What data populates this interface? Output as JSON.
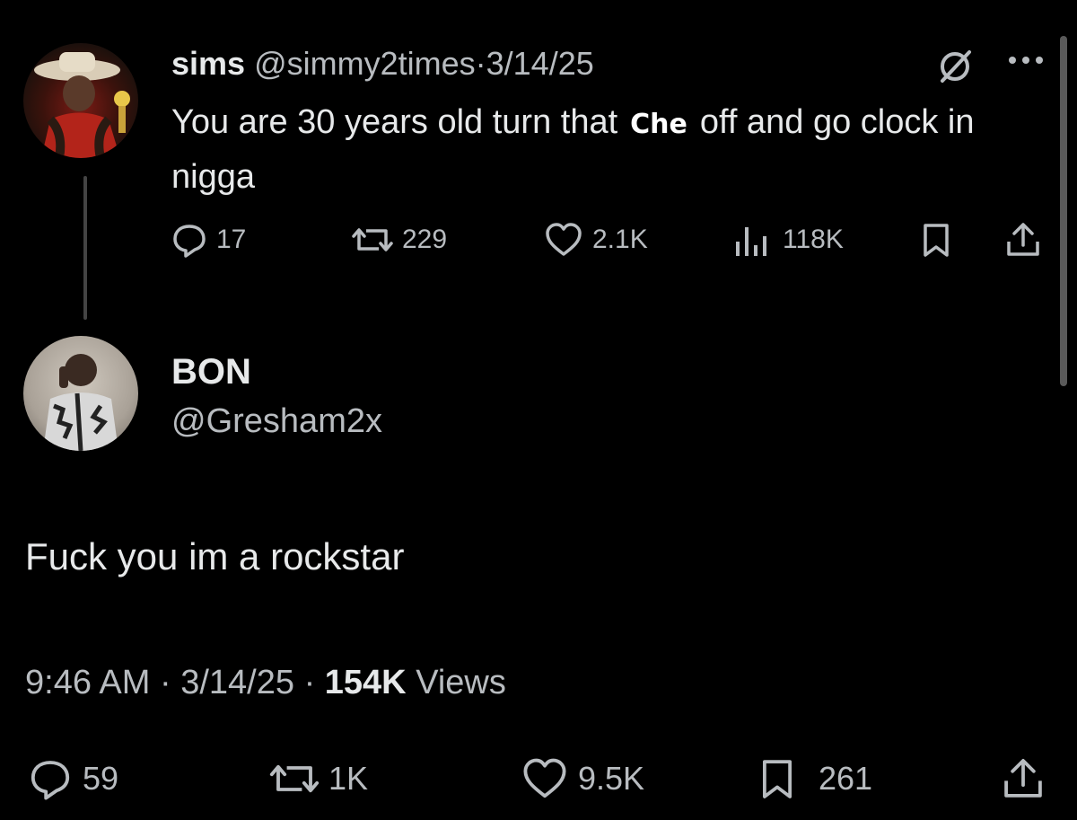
{
  "original_tweet": {
    "display_name": "sims",
    "handle": "@simmy2times",
    "separator": "·",
    "date": "3/14/25",
    "text_before": "You are 30 years old turn that",
    "text_highlight": "Che",
    "text_after": "off and go clock in nigga",
    "avatar": "avatar-cowboy-hat",
    "icons": {
      "grok": "grok-icon",
      "more": "more-options-icon"
    },
    "stats": {
      "replies": "17",
      "reposts": "229",
      "likes": "2.1K",
      "views": "118K"
    }
  },
  "reply_tweet": {
    "display_name": "BON",
    "handle": "@Gresham2x",
    "avatar": "avatar-man-jacket",
    "text": "Fuck you im a rockstar",
    "time": "9:46 AM",
    "separator": "·",
    "date": "3/14/25",
    "views_count": "154K",
    "views_label": "Views",
    "stats": {
      "replies": "59",
      "reposts": "1K",
      "likes": "9.5K",
      "bookmarks": "261"
    }
  },
  "colors": {
    "background": "#000000",
    "text": "#e7e9ea",
    "muted": "#b8bcc0"
  }
}
